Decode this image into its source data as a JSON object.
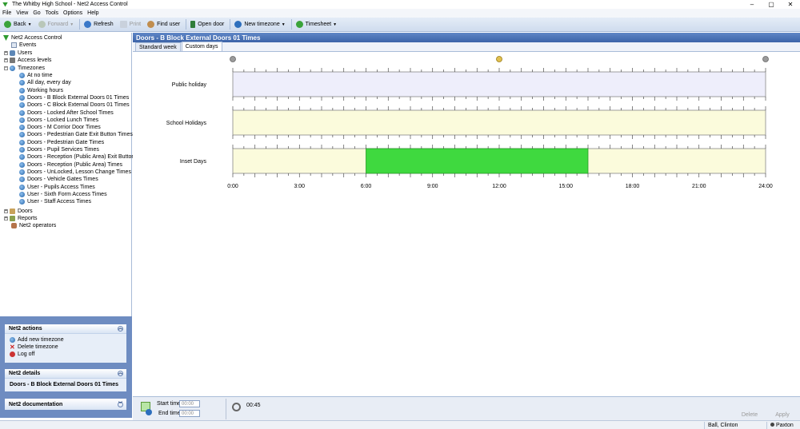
{
  "window": {
    "title": "The Whitby High School - Net2 Access Control"
  },
  "menu": [
    "File",
    "View",
    "Go",
    "Tools",
    "Options",
    "Help"
  ],
  "toolbar": {
    "back": "Back",
    "forward": "Forward",
    "refresh": "Refresh",
    "print": "Print",
    "find_user": "Find user",
    "open_door": "Open door",
    "new_timezone": "New timezone",
    "timesheet": "Timesheet"
  },
  "tree": {
    "root": "Net2 Access Control",
    "events": "Events",
    "users": "Users",
    "access_levels": "Access levels",
    "timezones": "Timezones",
    "timezone_items": [
      "At no time",
      "All day, every day",
      "Working hours",
      "Doors - B Block External Doors 01 Times",
      "Doors - C Block External Doors 01 Times",
      "Doors - Locked After School Times",
      "Doors - Locked Lunch Times",
      "Doors - M Corrior Door Times",
      "Doors - Pedestrian Gate Exit Button Times",
      "Doors - Pedestrian Gate Times",
      "Doors - Pupil Services Times",
      "Doors - Reception (Public Area) Exit Button Times",
      "Doors - Reception (Public Area) Times",
      "Doors - UnLocked, Lesson Change Times",
      "Doors - Vehicle Gates Times",
      "User - Pupils Access Times",
      "User - Sixth Form Access Times",
      "User - Staff Access Times"
    ],
    "doors": "Doors",
    "reports": "Reports",
    "operators": "Net2 operators"
  },
  "panes": {
    "actions_title": "Net2 actions",
    "add_timezone": "Add new timezone",
    "delete_timezone": "Delete timezone",
    "log_off": "Log off",
    "details_title": "Net2 details",
    "details_value": "Doors - B Block External Doors 01 Times",
    "documentation_title": "Net2 documentation"
  },
  "main": {
    "header": "Doors - B Block External Doors 01 Times",
    "tabs": [
      "Standard week",
      "Custom days"
    ]
  },
  "chart_data": {
    "type": "timeline",
    "x_unit": "hours",
    "x_range": [
      0,
      24
    ],
    "tick_labels": [
      "0:00",
      "3:00",
      "6:00",
      "9:00",
      "12:00",
      "15:00",
      "18:00",
      "21:00",
      "24:00"
    ],
    "rows": [
      {
        "label": "Public holiday",
        "color": "#eeeefb",
        "intervals": []
      },
      {
        "label": "School Holidays",
        "color": "#fbfbdc",
        "intervals": []
      },
      {
        "label": "Inset Days",
        "color": "#fbfbdc",
        "intervals": [
          [
            6.0,
            16.0
          ]
        ]
      }
    ],
    "interval_color": "#3fd93f"
  },
  "bottom": {
    "start_label": "Start time:",
    "end_label": "End time:",
    "start_value": "00:00",
    "end_value": "00:00",
    "duration": "00:45",
    "delete": "Delete",
    "apply": "Apply"
  },
  "status": {
    "user": "Ball, Clinton",
    "brand": "Paxton"
  }
}
